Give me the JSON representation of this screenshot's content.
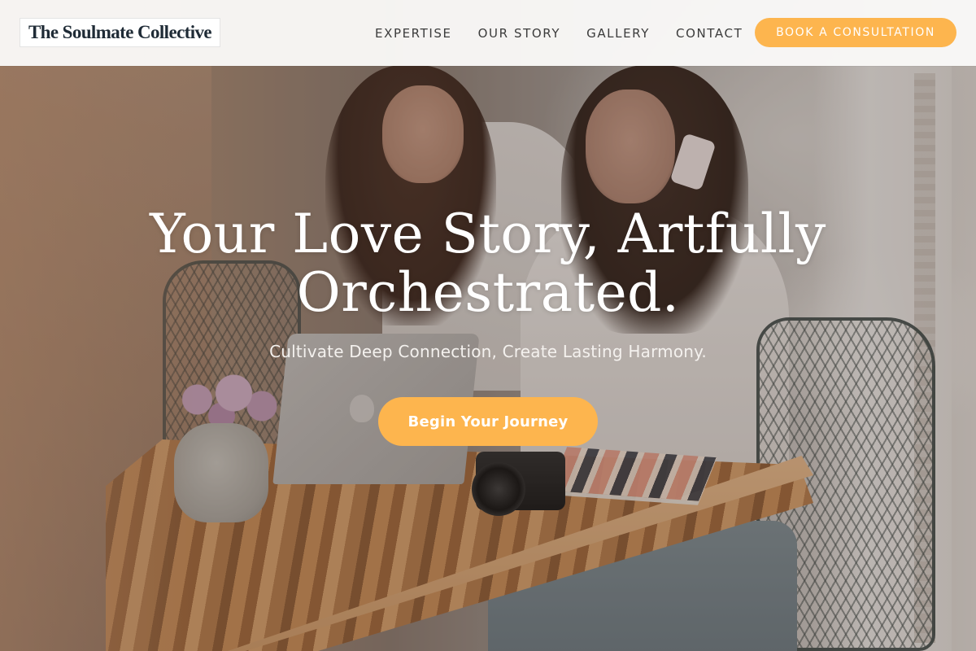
{
  "brand": {
    "name": "The Soulmate Collective"
  },
  "nav": {
    "items": [
      {
        "label": "EXPERTISE"
      },
      {
        "label": "OUR STORY"
      },
      {
        "label": "GALLERY"
      },
      {
        "label": "CONTACT"
      }
    ],
    "cta_label": "BOOK A CONSULTATION"
  },
  "hero": {
    "title": "Your Love Story, Artfully Orchestrated.",
    "subtitle": "Cultivate Deep Connection, Create Lasting Harmony.",
    "cta_label": "Begin Your Journey",
    "background_image": "two women at a wooden table with laptop, camera, notebook and flower vase"
  },
  "colors": {
    "accent": "#fdb54e",
    "header_bg": "#faf9f8",
    "nav_text": "#3c3c3c",
    "logo_text": "#1f2b36",
    "hero_text": "#ffffff"
  }
}
